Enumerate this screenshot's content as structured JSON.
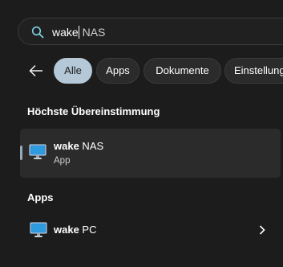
{
  "search": {
    "typed": "wake",
    "suggestion": " NAS"
  },
  "filters": {
    "items": [
      "Alle",
      "Apps",
      "Dokumente",
      "Einstellungen"
    ],
    "active": "Alle"
  },
  "sections": {
    "best_match_title": "Höchste Übereinstimmung",
    "apps_title": "Apps"
  },
  "best_match": {
    "name_bold": "wake",
    "name_rest": " NAS",
    "type": "App",
    "icon": "monitor-icon"
  },
  "apps": [
    {
      "name_bold": "wake",
      "name_rest": " PC",
      "icon": "monitor-icon"
    }
  ],
  "colors": {
    "background": "#1c1c1c",
    "active_pill": "#b5c8d8",
    "search_icon": "#7fd1e6"
  }
}
